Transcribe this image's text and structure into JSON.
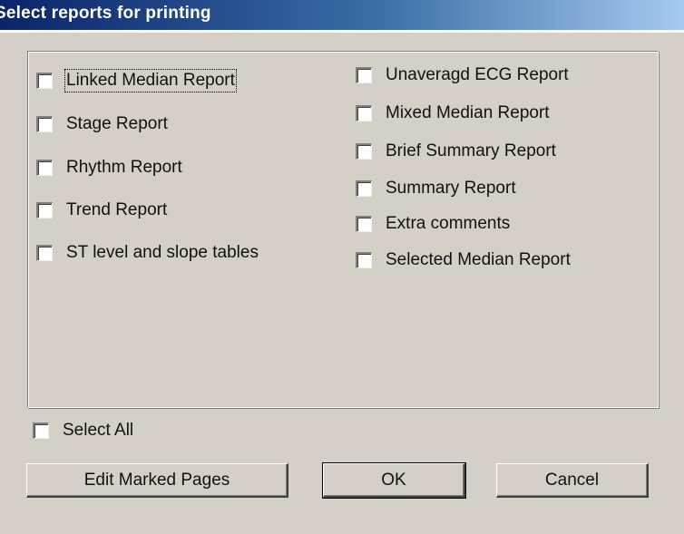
{
  "dialog": {
    "title": "Select reports for printing"
  },
  "left_column": [
    {
      "label": "Linked Median Report",
      "checked": false,
      "focused": true
    },
    {
      "label": "Stage Report",
      "checked": false
    },
    {
      "label": "Rhythm Report",
      "checked": false
    },
    {
      "label": "Trend Report",
      "checked": false
    },
    {
      "label": "ST level and slope tables",
      "checked": false
    }
  ],
  "right_column": [
    {
      "label": "Unaveragd ECG Report",
      "checked": false
    },
    {
      "label": "Mixed Median Report",
      "checked": false
    },
    {
      "label": "Brief Summary Report",
      "checked": false
    },
    {
      "label": "Summary Report",
      "checked": false
    },
    {
      "label": "Extra comments",
      "checked": false
    },
    {
      "label": "Selected Median Report",
      "checked": false
    }
  ],
  "select_all": {
    "label": "Select All",
    "checked": false
  },
  "buttons": {
    "edit_marked_pages": "Edit Marked Pages",
    "ok": "OK",
    "cancel": "Cancel"
  }
}
